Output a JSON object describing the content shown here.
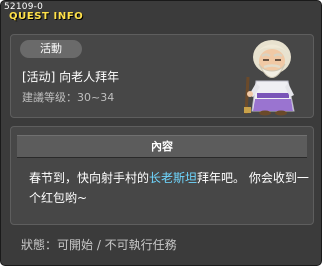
{
  "window": {
    "id": "52109-0",
    "title": "QUEST INFO"
  },
  "quest": {
    "category": "活動",
    "name": "[活动] 向老人拜年",
    "level": "建議等级：30~34",
    "npc_icon": "elder-npc-icon"
  },
  "content": {
    "header": "內容",
    "text_before": "春节到，快向射手村的",
    "npc_name": "长老斯坦",
    "text_after": "拜年吧。 你会收到一个红包哟~"
  },
  "status": {
    "text": "狀態：可開始 / 不可執行任務"
  },
  "colors": {
    "title": "#ffe14a",
    "highlight": "#6fd7ff",
    "window_bg": "#3b3b3b",
    "panel_bg": "#474747"
  }
}
